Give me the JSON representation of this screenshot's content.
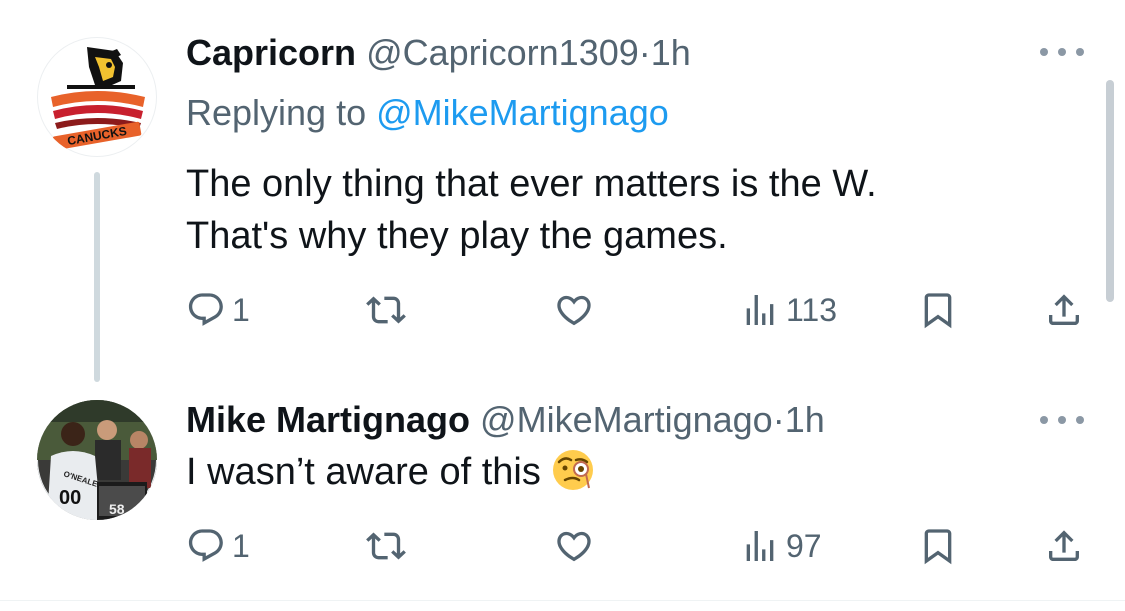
{
  "tweets": [
    {
      "name": "Capricorn",
      "handle": "@Capricorn1309",
      "separator": "·",
      "time": "1h",
      "replying_prefix": "Replying to ",
      "replying_to": "@MikeMartignago",
      "text_lines": [
        "The only thing that ever matters is the W.",
        "That's why they play the games."
      ],
      "avatar_text": "CANUCKS",
      "actions": {
        "replies": "1",
        "retweets": "",
        "likes": "",
        "views": "113"
      }
    },
    {
      "name": "Mike Martignago",
      "handle": "@MikeMartignago",
      "separator": "·",
      "time": "1h",
      "text": "I wasn’t aware of this",
      "emoji": "face-with-monocle",
      "avatar_jersey_name": "O'NEALE",
      "avatar_jersey_number": "00",
      "avatar_ref_number": "58",
      "actions": {
        "replies": "1",
        "retweets": "",
        "likes": "",
        "views": "97"
      }
    }
  ],
  "icons": {
    "more": "more-horizontal-icon",
    "reply": "reply-icon",
    "retweet": "retweet-icon",
    "like": "heart-icon",
    "views": "views-bar-chart-icon",
    "bookmark": "bookmark-icon",
    "share": "share-icon"
  },
  "colors": {
    "text_primary": "#0f1419",
    "text_secondary": "#536471",
    "link": "#1d9bf0",
    "thread_line": "#cfd9de"
  }
}
